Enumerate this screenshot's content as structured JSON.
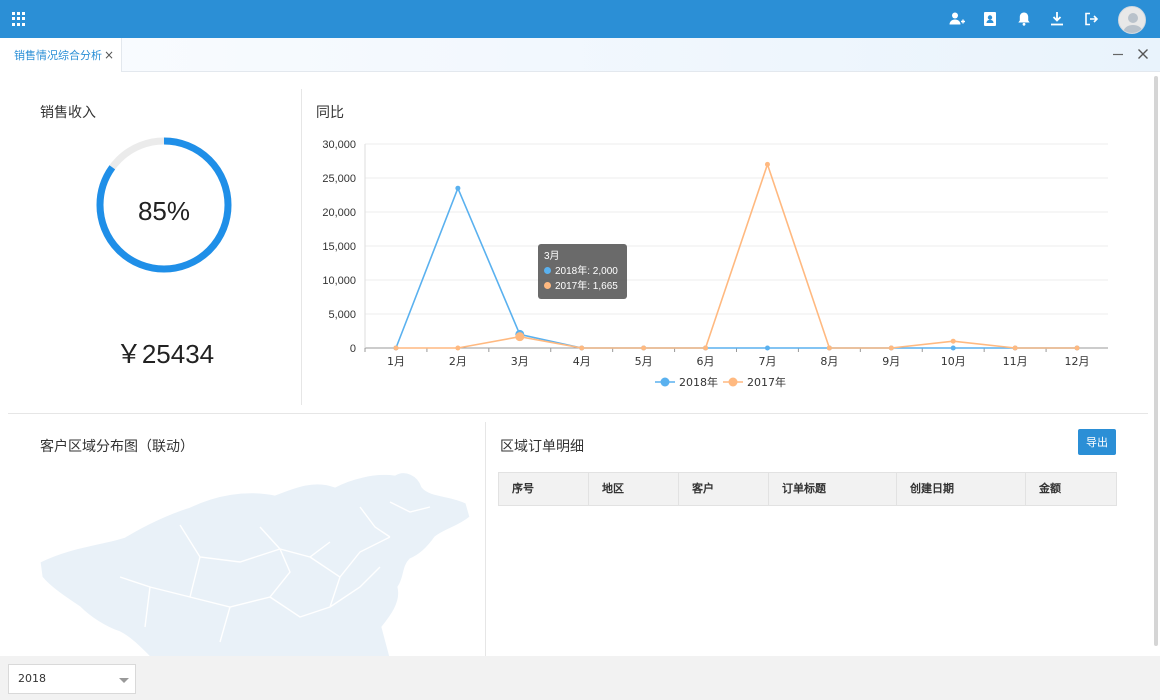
{
  "tab": {
    "label": "销售情况综合分析",
    "close": "×"
  },
  "sales": {
    "title": "销售收入",
    "percent_text": "85%",
    "percent": 0.85,
    "amount": "￥25434"
  },
  "yoy": {
    "title": "同比"
  },
  "chart_data": {
    "type": "line",
    "categories": [
      "1月",
      "2月",
      "3月",
      "4月",
      "5月",
      "6月",
      "7月",
      "8月",
      "9月",
      "10月",
      "11月",
      "12月"
    ],
    "series": [
      {
        "name": "2018年",
        "color": "#5ab1ef",
        "values": [
          0,
          23500,
          2000,
          0,
          0,
          0,
          0,
          0,
          0,
          0,
          0,
          0
        ]
      },
      {
        "name": "2017年",
        "color": "#ffb980",
        "values": [
          0,
          0,
          1665,
          0,
          0,
          0,
          27000,
          0,
          0,
          1000,
          0,
          0
        ]
      }
    ],
    "ylim": [
      0,
      30000
    ],
    "yticks": [
      0,
      5000,
      10000,
      15000,
      20000,
      25000,
      30000
    ],
    "ytick_labels": [
      "0",
      "5,000",
      "10,000",
      "15,000",
      "20,000",
      "25,000",
      "30,000"
    ],
    "grid": true,
    "legend": "bottom-center",
    "tooltip": {
      "title": "3月",
      "rows": [
        "2018年: 2,000",
        "2017年: 1,665"
      ]
    }
  },
  "region": {
    "title": "客户区域分布图（联动）"
  },
  "orders": {
    "title": "区域订单明细",
    "export_label": "导出",
    "columns": [
      "序号",
      "地区",
      "客户",
      "订单标题",
      "创建日期",
      "金额"
    ]
  },
  "year_select": {
    "value": "2018"
  },
  "icons": [
    "apps-icon",
    "add-user-icon",
    "contacts-icon",
    "bell-icon",
    "download-icon",
    "logout-icon",
    "avatar",
    "minimize-icon",
    "close-icon"
  ]
}
